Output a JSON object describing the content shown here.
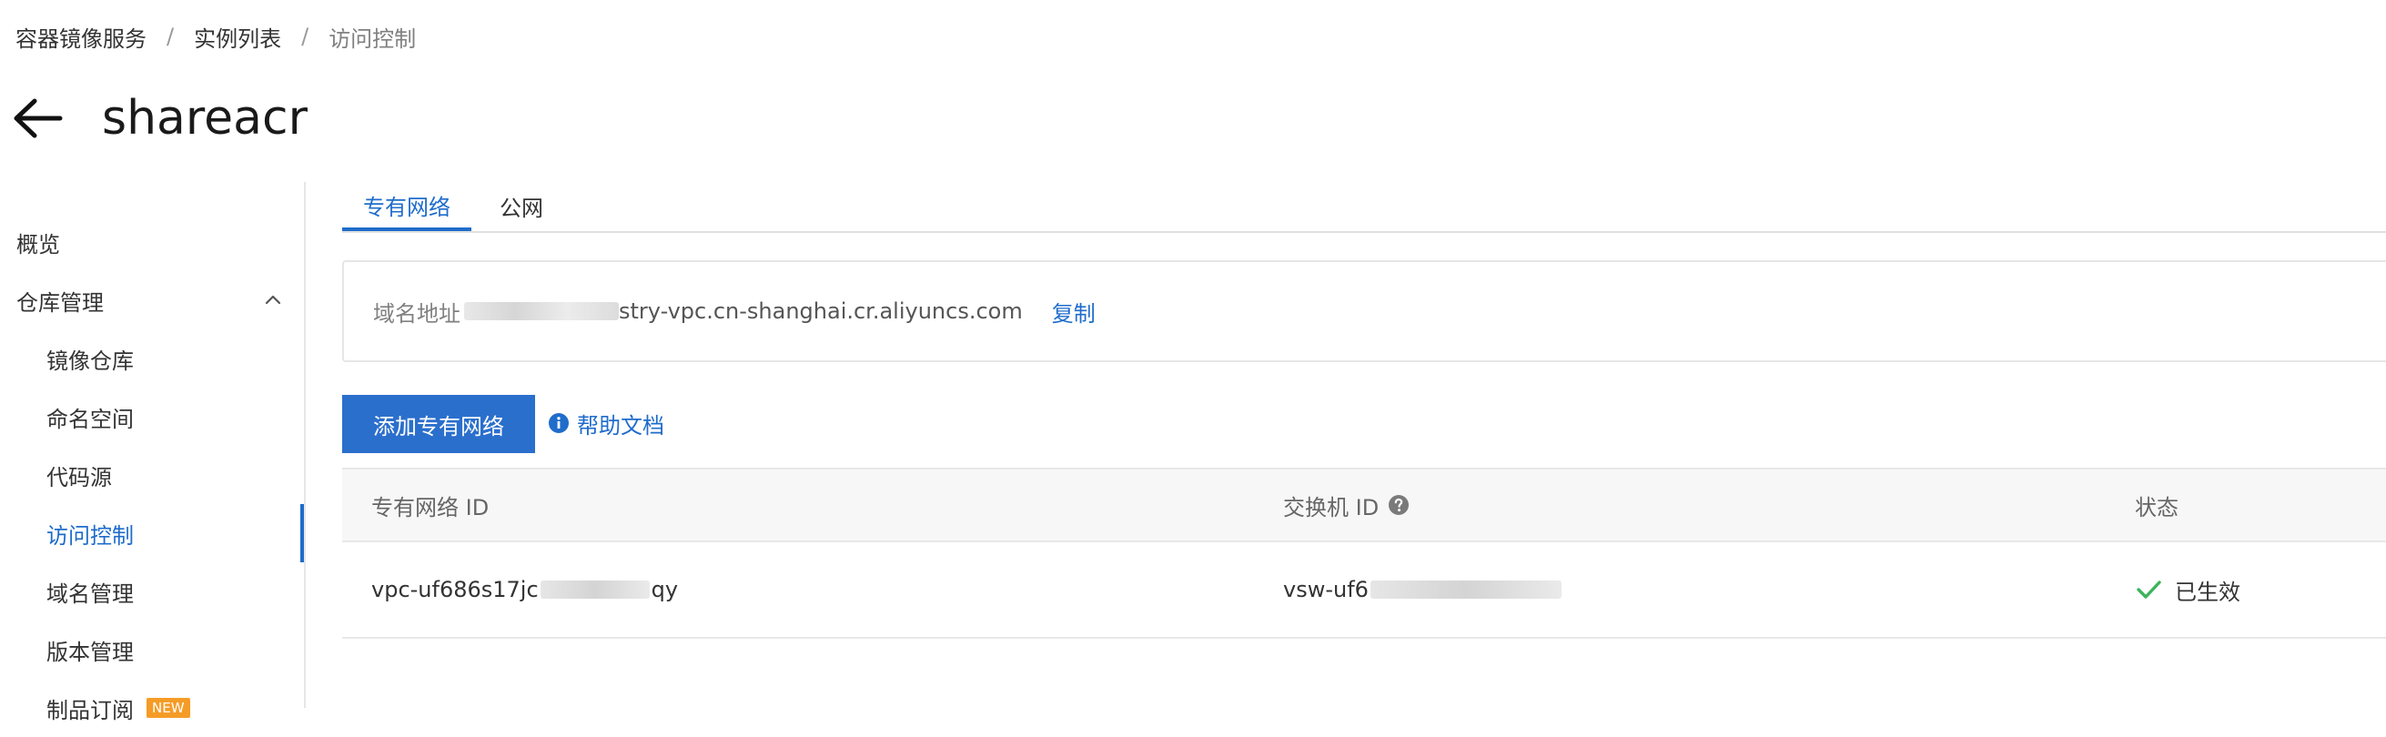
{
  "breadcrumb": {
    "items": [
      "容器镜像服务",
      "实例列表",
      "访问控制"
    ],
    "separator": "/"
  },
  "header": {
    "title": "shareacr"
  },
  "sidebar": {
    "overview": "概览",
    "repo_management": "仓库管理",
    "items": [
      "镜像仓库",
      "命名空间",
      "代码源",
      "访问控制",
      "域名管理",
      "版本管理",
      "制品订阅"
    ],
    "new_badge": "NEW",
    "active_index": 3
  },
  "tabs": {
    "vpc": "专有网络",
    "public": "公网"
  },
  "domain": {
    "label": "域名地址",
    "value_visible": "stry-vpc.cn-shanghai.cr.aliyuncs.com",
    "copy": "复制"
  },
  "actions": {
    "add_vpc": "添加专有网络",
    "help_doc": "帮助文档"
  },
  "table": {
    "headers": {
      "vpc_id": "专有网络 ID",
      "vswitch_id": "交换机 ID",
      "status": "状态"
    },
    "rows": [
      {
        "vpc_prefix": "vpc-uf686s17jc",
        "vpc_suffix": "qy",
        "vswitch_prefix": "vsw-uf6",
        "status": "已生效"
      }
    ]
  },
  "colors": {
    "accent": "#1f6ccb",
    "button": "#2b6fcc",
    "success": "#3cb35b",
    "badge": "#f59c27"
  }
}
